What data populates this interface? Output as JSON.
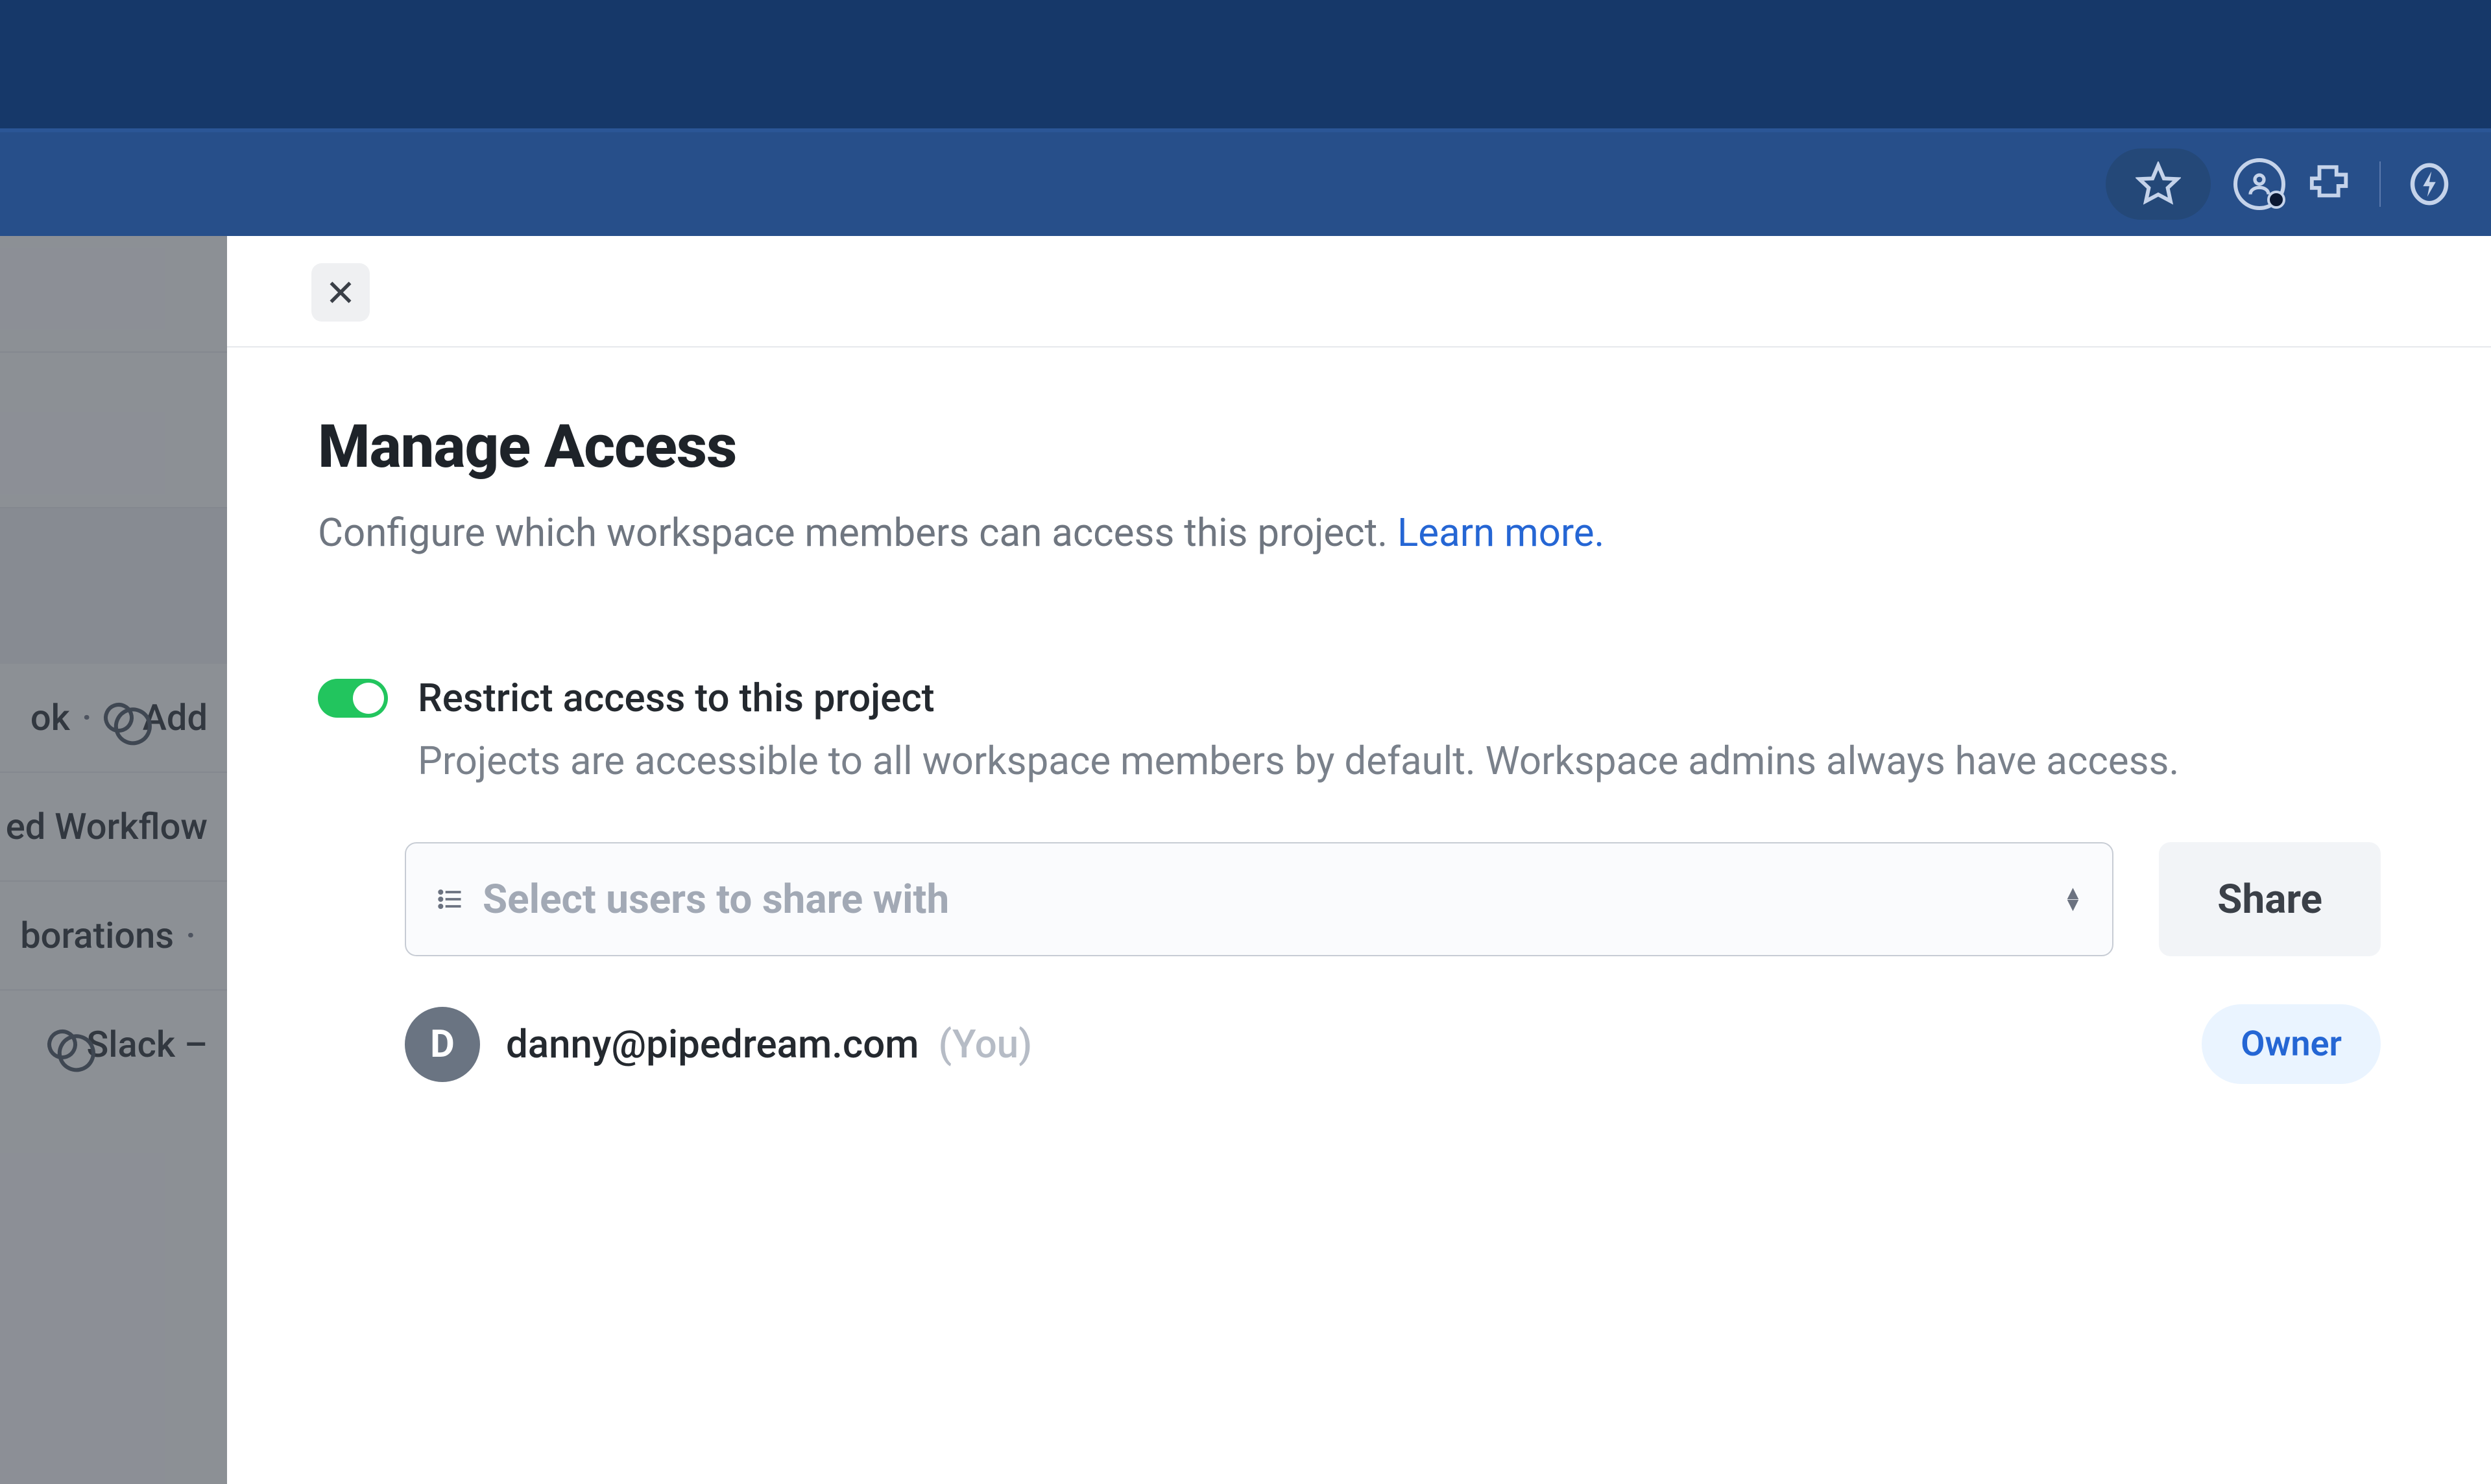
{
  "modal": {
    "title": "Manage Access",
    "subtitle_prefix": "Configure which workspace members can access this project. ",
    "learn_more_label": "Learn more.",
    "restrict_label": "Restrict access to this project",
    "restrict_desc": "Projects are accessible to all workspace members by default. Workspace admins always have access.",
    "select_placeholder": "Select users to share with",
    "share_label": "Share",
    "member": {
      "initial": "D",
      "email": "danny@pipedream.com",
      "you_suffix": "(You)",
      "role": "Owner"
    }
  },
  "sidebar": {
    "row1_a": "ok",
    "row1_b": "Add",
    "row2": "ed Workflow",
    "row3": "borations",
    "row4": "Slack –"
  }
}
